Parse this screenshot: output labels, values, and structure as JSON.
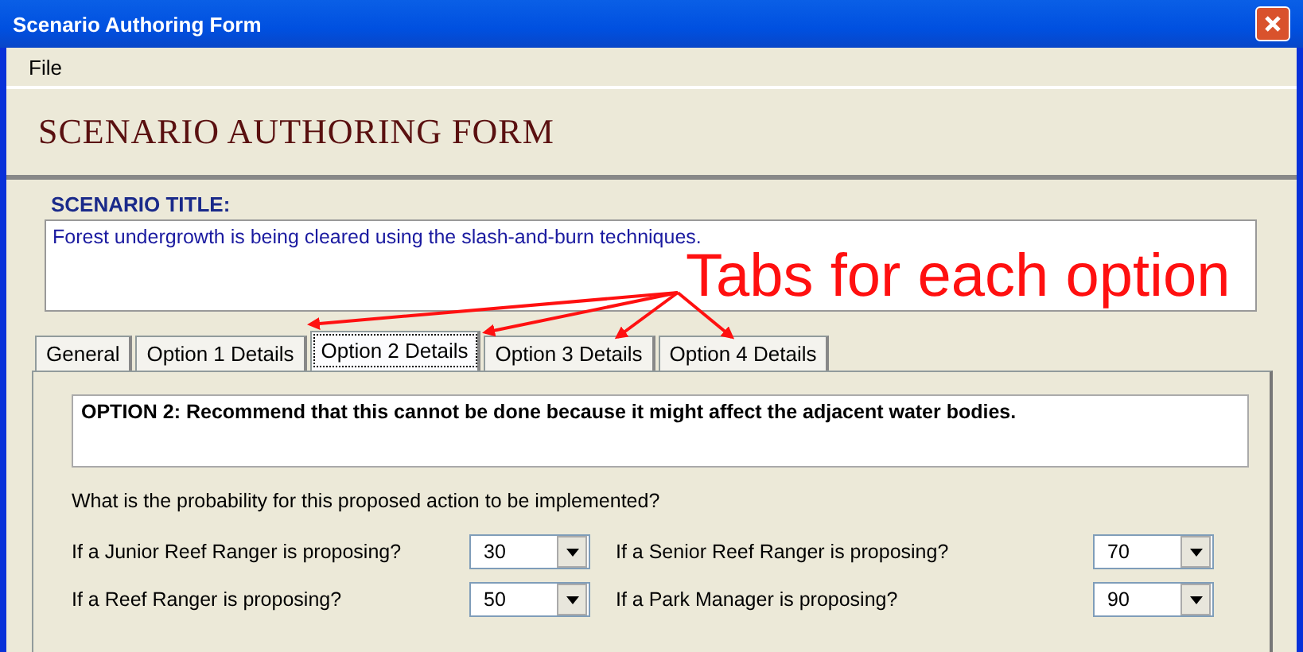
{
  "window": {
    "title": "Scenario Authoring Form"
  },
  "menu": [
    "File"
  ],
  "heading": "SCENARIO AUTHORING FORM",
  "scenario_title": {
    "label": "SCENARIO TITLE:",
    "value": "Forest undergrowth is being cleared using the slash-and-burn techniques."
  },
  "tabs": [
    {
      "label": "General",
      "selected": false
    },
    {
      "label": "Option 1 Details",
      "selected": false
    },
    {
      "label": "Option 2 Details",
      "selected": true
    },
    {
      "label": "Option 3 Details",
      "selected": false
    },
    {
      "label": "Option 4 Details",
      "selected": false
    }
  ],
  "option_text": "OPTION 2: Recommend that this cannot be done because it might affect the adjacent water bodies.",
  "question": "What is the probability for this proposed action to be implemented?",
  "probabilities": [
    {
      "label": "If a Junior Reef Ranger is proposing?",
      "value": "30"
    },
    {
      "label": "If a Senior Reef Ranger is proposing?",
      "value": "70"
    },
    {
      "label": "If a Reef Ranger is proposing?",
      "value": "50"
    },
    {
      "label": "If a Park Manager is proposing?",
      "value": "90"
    }
  ],
  "annotation": {
    "text": "Tabs for each option"
  }
}
